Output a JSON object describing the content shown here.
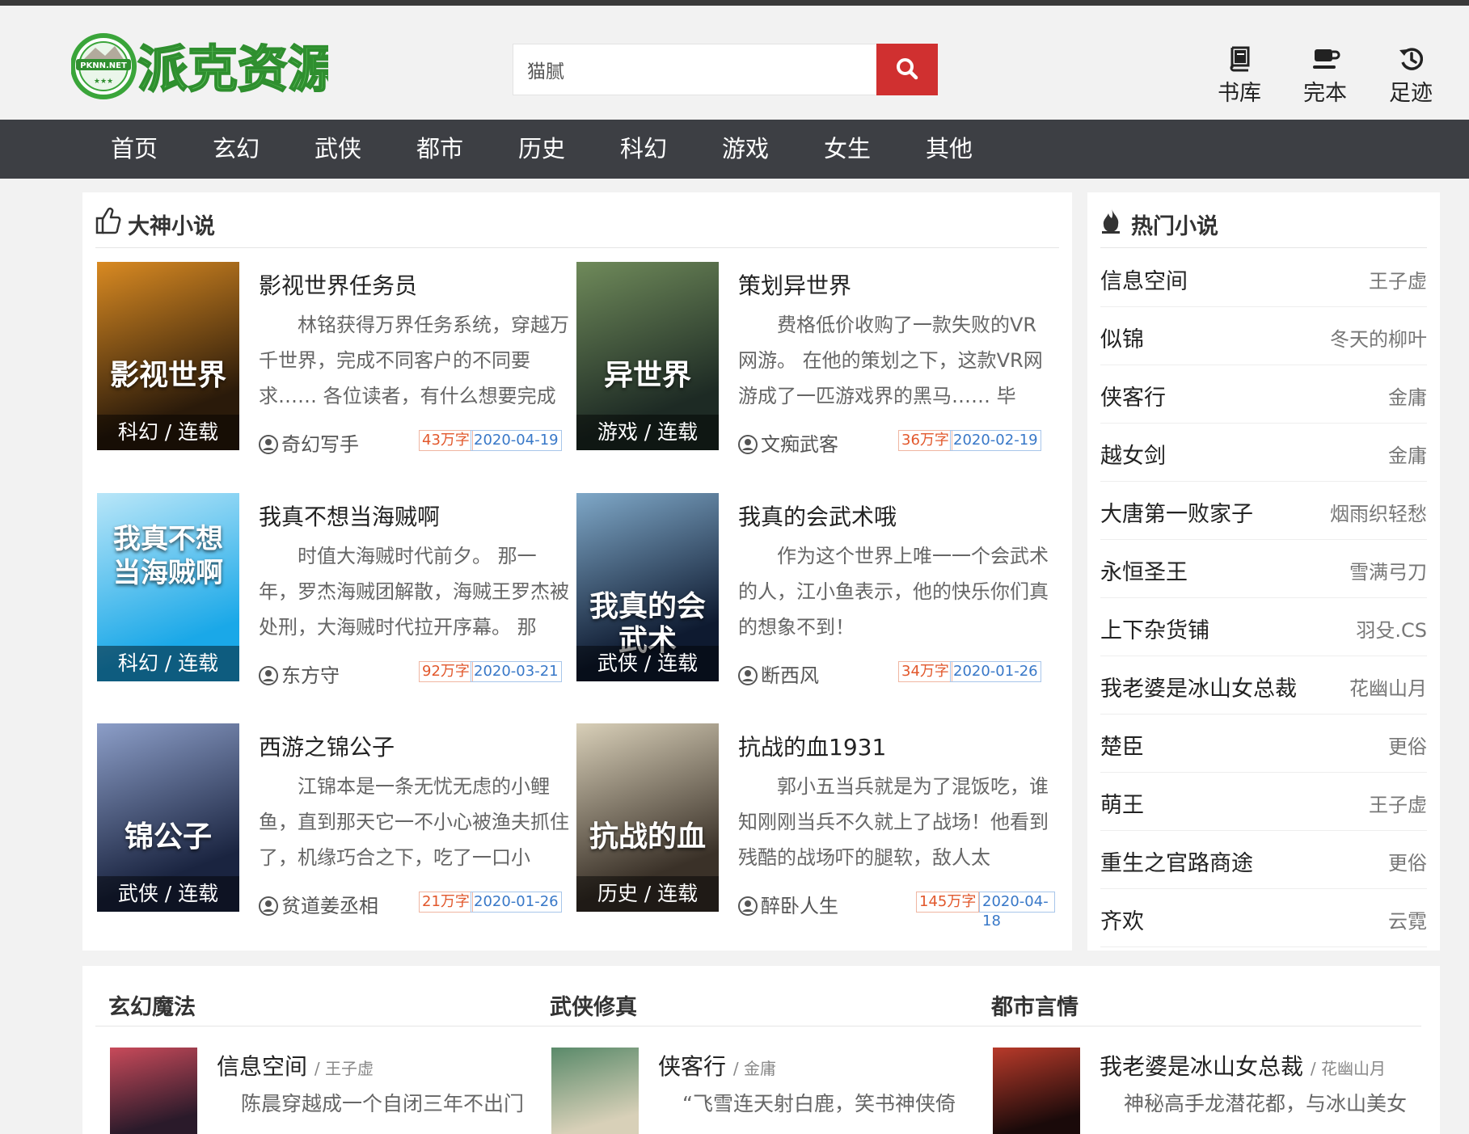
{
  "site": {
    "logo_small": "PKNN.NET",
    "logo_text": "派克资源",
    "logo_stars": "★★★"
  },
  "search": {
    "value": "猫腻",
    "icon": "search-icon"
  },
  "quick_links": [
    {
      "label": "书库",
      "icon": "book-icon"
    },
    {
      "label": "完本",
      "icon": "cup-icon"
    },
    {
      "label": "足迹",
      "icon": "history-icon"
    }
  ],
  "nav": [
    "首页",
    "玄幻",
    "武侠",
    "都市",
    "历史",
    "科幻",
    "游戏",
    "女生",
    "其他"
  ],
  "featured": {
    "title": "大神小说",
    "icon": "thumbs-up-icon",
    "books": [
      {
        "title": "影视世界任务员",
        "desc": "林铭获得万界任务系统，穿越万千世界，完成不同客户的不同要求…… 各位读者，有什么想要完成",
        "author": "奇幻写手",
        "words": "43万字",
        "date": "2020-04-19",
        "tag": "科幻 / 连载",
        "cover_text": "影视世界",
        "colors": [
          "#2a1a0a",
          "#d98a22"
        ]
      },
      {
        "title": "策划异世界",
        "desc": "费格低价收购了一款失败的VR网游。 在他的策划之下，这款VR网游成了一匹游戏界的黑马…… 毕",
        "author": "文痴武客",
        "words": "36万字",
        "date": "2020-02-19",
        "tag": "游戏 / 连载",
        "cover_text": "异世界",
        "colors": [
          "#1d2a24",
          "#6f8a5a"
        ]
      },
      {
        "title": "我真不想当海贼啊",
        "desc": "时值大海贼时代前夕。 那一年，罗杰海贼团解散，海贼王罗杰被处刑，大海贼时代拉开序幕。 那",
        "author": "东方守",
        "words": "92万字",
        "date": "2020-03-21",
        "tag": "科幻 / 连载",
        "cover_text": "我真不想当海贼啊",
        "colors": [
          "#1aa8e8",
          "#b9e6f8"
        ]
      },
      {
        "title": "我真的会武术哦",
        "desc": "作为这个世界上唯一一个会武术的人，江小鱼表示，他的快乐你们真的想象不到！",
        "author": "断西风",
        "words": "34万字",
        "date": "2020-01-26",
        "tag": "武侠 / 连载",
        "cover_text": "我真的会武术",
        "colors": [
          "#0e1a30",
          "#7fa8c8"
        ]
      },
      {
        "title": "西游之锦公子",
        "desc": "江锦本是一条无忧无虑的小鲤鱼，直到那天它一不小心被渔夫抓住了，机缘巧合之下，吃了一口小",
        "author": "贫道姜丞相",
        "words": "21万字",
        "date": "2020-01-26",
        "tag": "武侠 / 连载",
        "cover_text": "锦公子",
        "colors": [
          "#1a2440",
          "#8c9ec8"
        ]
      },
      {
        "title": "抗战的血1931",
        "desc": "郭小五当兵就是为了混饭吃，谁知刚刚当兵不久就上了战场！他看到残酷的战场吓的腿软，敌人太",
        "author": "醉卧人生",
        "words": "145万字",
        "date": "2020-04-18",
        "tag": "历史 / 连载",
        "cover_text": "抗战的血",
        "colors": [
          "#3a3128",
          "#d8cfb8"
        ]
      }
    ]
  },
  "hot": {
    "title": "热门小说",
    "icon": "flame-icon",
    "items": [
      {
        "title": "信息空间",
        "author": "王子虚"
      },
      {
        "title": "似锦",
        "author": "冬天的柳叶"
      },
      {
        "title": "侠客行",
        "author": "金庸"
      },
      {
        "title": "越女剑",
        "author": "金庸"
      },
      {
        "title": "大唐第一败家子",
        "author": "烟雨织轻愁"
      },
      {
        "title": "永恒圣王",
        "author": "雪满弓刀"
      },
      {
        "title": "上下杂货铺",
        "author": "羽殳.CS"
      },
      {
        "title": "我老婆是冰山女总裁",
        "author": "花幽山月"
      },
      {
        "title": "楚臣",
        "author": "更俗"
      },
      {
        "title": "萌王",
        "author": "王子虚"
      },
      {
        "title": "重生之官路商途",
        "author": "更俗"
      },
      {
        "title": "齐欢",
        "author": "云霓"
      }
    ]
  },
  "sections": [
    {
      "title": "玄幻魔法",
      "book": {
        "title": "信息空间",
        "author": "/ 王子虚",
        "desc": "陈晨穿越成一个自闭三年不出门",
        "colors": [
          "#2a1a2a",
          "#c84a5a"
        ]
      }
    },
    {
      "title": "武侠修真",
      "book": {
        "title": "侠客行",
        "author": "/ 金庸",
        "desc": "“飞雪连天射白鹿，笑书神侠倚",
        "colors": [
          "#d8d0b8",
          "#5a8a6a"
        ]
      }
    },
    {
      "title": "都市言情",
      "book": {
        "title": "我老婆是冰山女总裁",
        "author": "/ 花幽山月",
        "desc": "神秘高手龙潜花都，与冰山美女",
        "colors": [
          "#1a0a0a",
          "#b83a2a"
        ]
      }
    }
  ]
}
